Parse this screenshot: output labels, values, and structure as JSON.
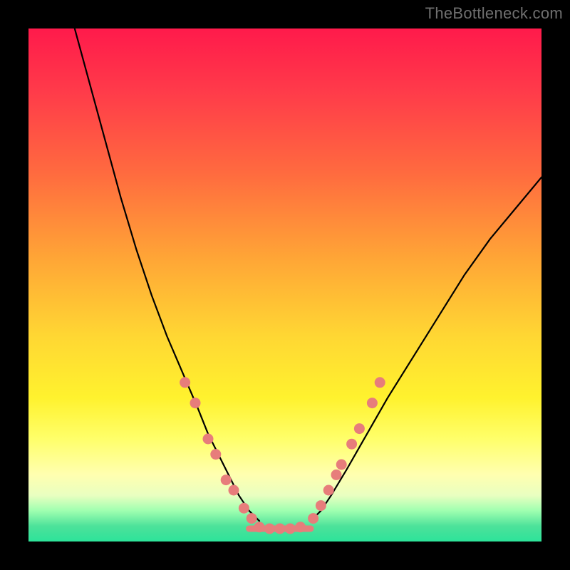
{
  "watermark": "TheBottleneck.com",
  "chart_data": {
    "type": "line",
    "title": "",
    "xlabel": "",
    "ylabel": "",
    "xlim": [
      0,
      100
    ],
    "ylim": [
      0,
      100
    ],
    "grid": false,
    "legend": false,
    "series": [
      {
        "name": "left-curve",
        "stroke": "#000000",
        "x": [
          9,
          12,
          15,
          18,
          21,
          24,
          27,
          30,
          33,
          35,
          37,
          39,
          41,
          43,
          45
        ],
        "y": [
          100,
          89,
          78,
          67,
          57,
          48,
          40,
          33,
          26,
          21,
          17,
          13,
          9,
          6,
          4
        ]
      },
      {
        "name": "right-curve",
        "stroke": "#000000",
        "x": [
          55,
          57,
          59,
          62,
          66,
          70,
          75,
          80,
          85,
          90,
          95,
          100
        ],
        "y": [
          4,
          6,
          9,
          14,
          21,
          28,
          36,
          44,
          52,
          59,
          65,
          71
        ]
      },
      {
        "name": "flat-segment",
        "stroke": "#e77d7b",
        "x": [
          43,
          46,
          49,
          52,
          55
        ],
        "y": [
          2.5,
          2.5,
          2.5,
          2.5,
          2.5
        ]
      }
    ],
    "scatter": [
      {
        "name": "left-dots",
        "color": "#e77d7b",
        "points": [
          {
            "x": 30.5,
            "y": 31
          },
          {
            "x": 32.5,
            "y": 27
          },
          {
            "x": 35.0,
            "y": 20
          },
          {
            "x": 36.5,
            "y": 17
          },
          {
            "x": 38.5,
            "y": 12
          },
          {
            "x": 40.0,
            "y": 10
          },
          {
            "x": 42.0,
            "y": 6.5
          },
          {
            "x": 43.5,
            "y": 4.5
          }
        ]
      },
      {
        "name": "right-dots",
        "color": "#e77d7b",
        "points": [
          {
            "x": 55.5,
            "y": 4.5
          },
          {
            "x": 57.0,
            "y": 7
          },
          {
            "x": 58.5,
            "y": 10
          },
          {
            "x": 60.0,
            "y": 13
          },
          {
            "x": 61.0,
            "y": 15
          },
          {
            "x": 63.0,
            "y": 19
          },
          {
            "x": 64.5,
            "y": 22
          },
          {
            "x": 67.0,
            "y": 27
          },
          {
            "x": 68.5,
            "y": 31
          }
        ]
      },
      {
        "name": "flat-dots",
        "color": "#e77d7b",
        "points": [
          {
            "x": 45.0,
            "y": 2.8
          },
          {
            "x": 47.0,
            "y": 2.5
          },
          {
            "x": 49.0,
            "y": 2.5
          },
          {
            "x": 51.0,
            "y": 2.5
          },
          {
            "x": 53.0,
            "y": 2.8
          }
        ]
      }
    ]
  }
}
